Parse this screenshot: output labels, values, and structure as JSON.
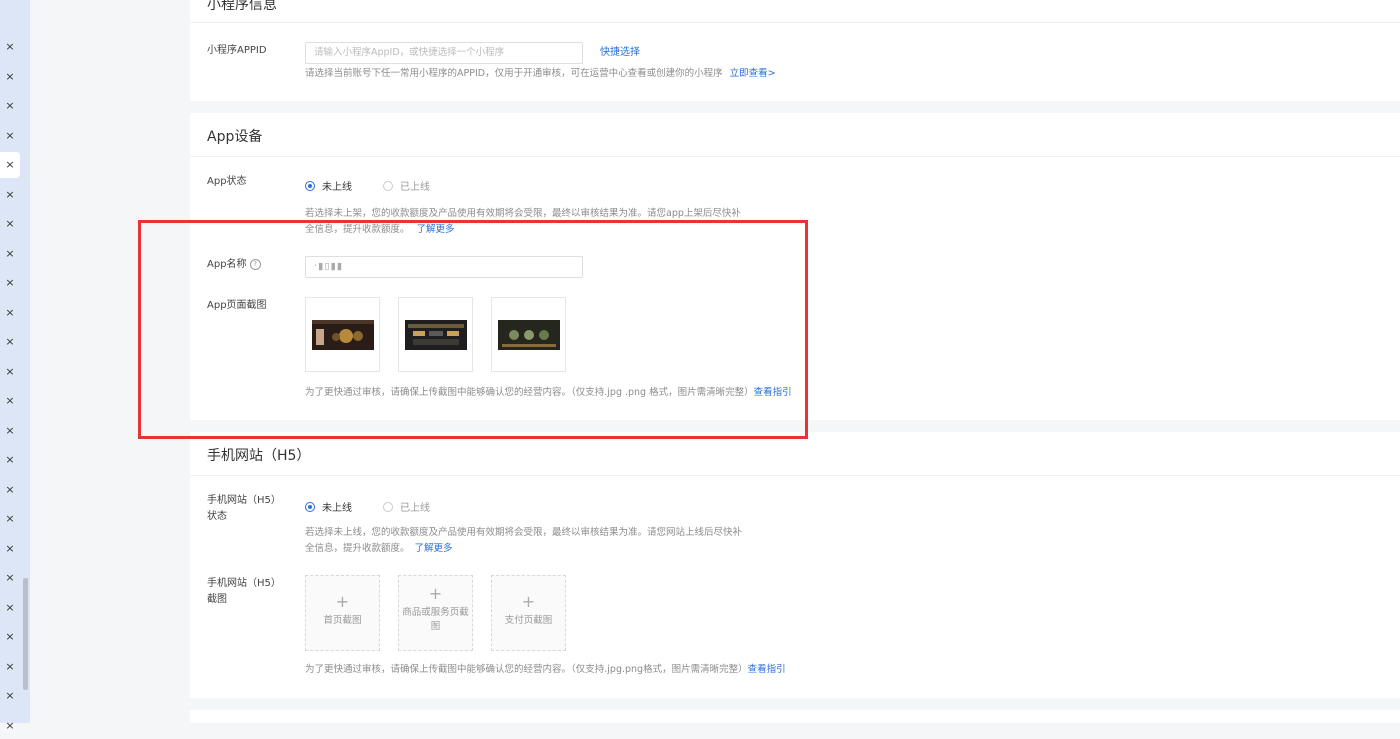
{
  "sidebar": {
    "close_glyph": "×",
    "tab_count": 24,
    "active_index": 4
  },
  "mini_program": {
    "section_title": "小程序信息",
    "appid_label": "小程序APPID",
    "appid_placeholder": "请输入小程序AppID，或快捷选择一个小程序",
    "quick_select": "快捷选择",
    "help_text": "请选择当前账号下任一常用小程序的APPID，仅用于开通审核，可在运营中心查看或创建你的小程序",
    "view_now": "立即查看>"
  },
  "app_device": {
    "section_title": "App设备",
    "status_label": "App状态",
    "radio_offline": "未上线",
    "radio_online": "已上线",
    "status_help_1": "若选择未上架，您的收款额度及产品使用有效期将会受限，最终以审核结果为准。请您app上架后尽快补",
    "status_help_2": "全信息，提升收款额度。",
    "learn_more": "了解更多",
    "name_label": "App名称",
    "name_help_icon": "?",
    "name_value": "·▮▯▮▮",
    "screenshot_label": "App页面截图",
    "screenshot_help": "为了更快通过审核，请确保上传截图中能够确认您的经营内容。（仅支持.jpg .png 格式，图片需清晰完整）",
    "view_guide": "查看指引"
  },
  "h5": {
    "section_title": "手机网站（H5）",
    "status_label_1": "手机网站（H5）",
    "status_label_2": "状态",
    "radio_offline": "未上线",
    "radio_online": "已上线",
    "status_help_1": "若选择未上线，您的收款额度及产品使用有效期将会受限，最终以审核结果为准。请您网站上线后尽快补",
    "status_help_2": "全信息，提升收款额度。",
    "learn_more": "了解更多",
    "screenshot_label_1": "手机网站（H5）",
    "screenshot_label_2": "截图",
    "upload_plus": "+",
    "upload_home": "首页截图",
    "upload_product": "商品或服务页截图",
    "upload_pay": "支付页截图",
    "screenshot_help": "为了更快通过审核，请确保上传截图中能够确认您的经营内容。（仅支持.jpg.png格式，图片需清晰完整）",
    "view_guide": "查看指引"
  },
  "colors": {
    "accent": "#2a6fdb",
    "highlight": "#e63333"
  }
}
